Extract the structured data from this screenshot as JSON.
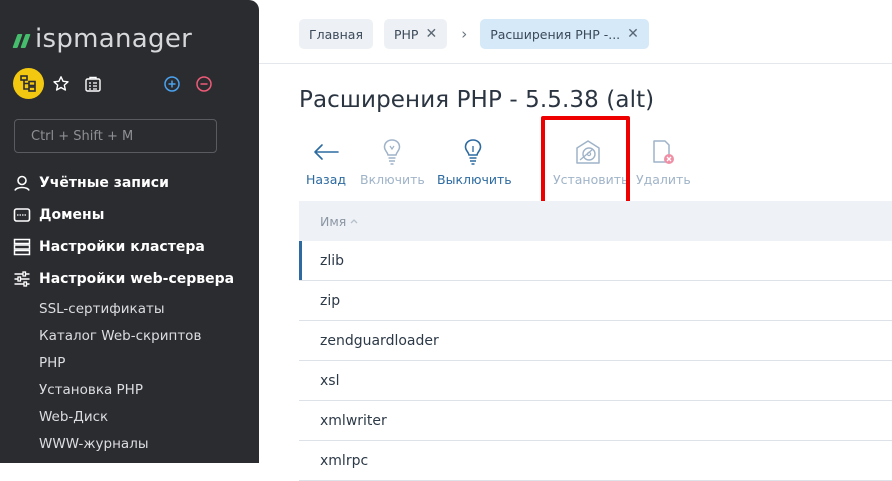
{
  "sidebar": {
    "logo": "ispmanager",
    "search_placeholder": "Ctrl + Shift + M",
    "nav": [
      {
        "label": "Учётные записи"
      },
      {
        "label": "Домены"
      },
      {
        "label": "Настройки кластера"
      },
      {
        "label": "Настройки web-сервера"
      }
    ],
    "sub": [
      "SSL-сертификаты",
      "Каталог Web-скриптов",
      "PHP",
      "Установка PHP",
      "Web-Диск",
      "WWW-журналы"
    ]
  },
  "breadcrumbs": [
    {
      "label": "Главная"
    },
    {
      "label": "PHP"
    },
    {
      "label": "Расширения PHP -..."
    }
  ],
  "page": {
    "title": "Расширения PHP - 5.5.38 (alt)"
  },
  "toolbar": [
    {
      "label": "Назад",
      "icon": "arrow-left-icon",
      "enabled": true
    },
    {
      "label": "Включить",
      "icon": "lightbulb-on-icon",
      "enabled": false
    },
    {
      "label": "Выключить",
      "icon": "lightbulb-off-icon",
      "enabled": true
    },
    {
      "label": "Установить",
      "icon": "install-icon",
      "enabled": false
    },
    {
      "label": "Удалить",
      "icon": "delete-icon",
      "enabled": false
    }
  ],
  "table": {
    "column_header": "Имя",
    "sort_indicator": "^",
    "rows": [
      "zlib",
      "zip",
      "zendguardloader",
      "xsl",
      "xmlwriter",
      "xmlrpc"
    ]
  },
  "colors": {
    "sidebar_bg": "#2b2c30",
    "accent_blue": "#2c6aa0",
    "logo_green": "#46bd6c",
    "highlight_red": "#ee0000"
  }
}
